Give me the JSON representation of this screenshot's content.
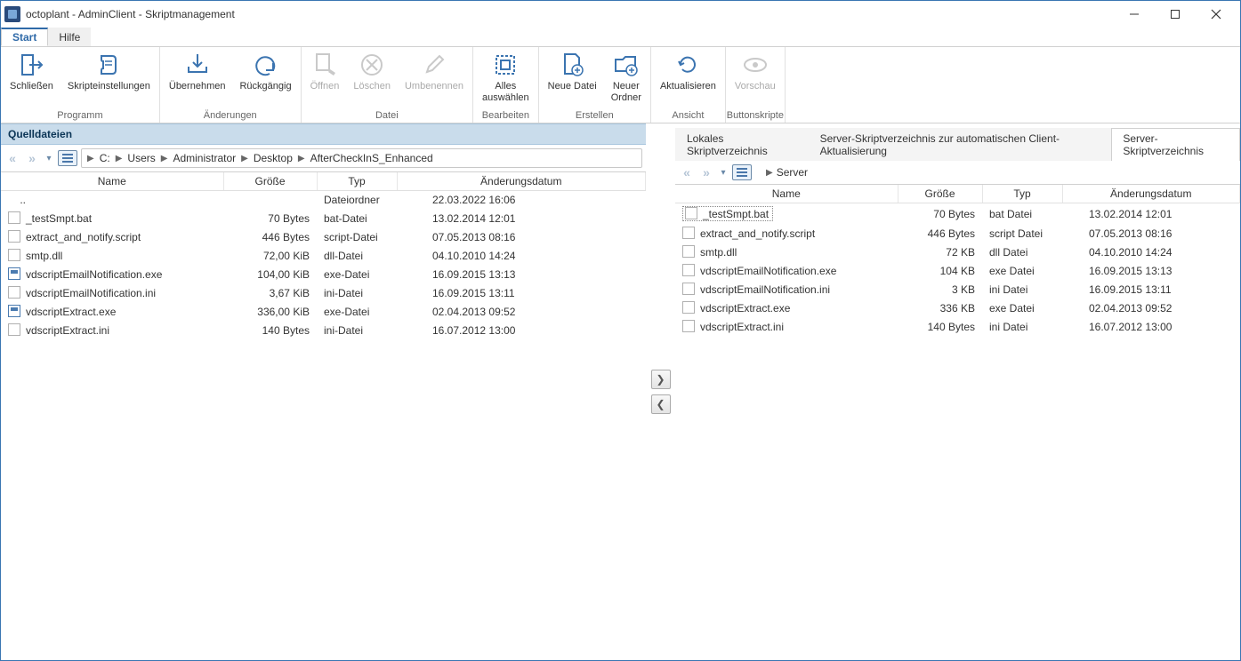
{
  "window": {
    "title": "octoplant - AdminClient - Skriptmanagement"
  },
  "menu": {
    "start": "Start",
    "help": "Hilfe"
  },
  "ribbon": {
    "close": "Schließen",
    "settings": "Skripteinstellungen",
    "group_program": "Programm",
    "apply": "Übernehmen",
    "undo": "Rückgängig",
    "group_changes": "Änderungen",
    "open": "Öffnen",
    "delete": "Löschen",
    "rename": "Umbenennen",
    "group_file": "Datei",
    "select_all1": "Alles",
    "select_all2": "auswählen",
    "group_edit": "Bearbeiten",
    "new_file": "Neue Datei",
    "new_folder1": "Neuer",
    "new_folder2": "Ordner",
    "group_create": "Erstellen",
    "refresh": "Aktualisieren",
    "group_view": "Ansicht",
    "preview": "Vorschau",
    "group_button": "Buttonskripte"
  },
  "left": {
    "header": "Quelldateien",
    "breadcrumb": [
      "C:",
      "Users",
      "Administrator",
      "Desktop",
      "AfterCheckInS_Enhanced"
    ],
    "columns": {
      "name": "Name",
      "size": "Größe",
      "type": "Typ",
      "date": "Änderungsdatum"
    },
    "parent_type": "Dateiordner",
    "parent_date": "22.03.2022 16:06",
    "rows": [
      {
        "name": "_testSmpt.bat",
        "size": "70 Bytes",
        "type": "bat-Datei",
        "date": "13.02.2014 12:01",
        "icon": "bat"
      },
      {
        "name": "extract_and_notify.script",
        "size": "446 Bytes",
        "type": "script-Datei",
        "date": "07.05.2013 08:16",
        "icon": "txt"
      },
      {
        "name": "smtp.dll",
        "size": "72,00 KiB",
        "type": "dll-Datei",
        "date": "04.10.2010 14:24",
        "icon": "dll"
      },
      {
        "name": "vdscriptEmailNotification.exe",
        "size": "104,00 KiB",
        "type": "exe-Datei",
        "date": "16.09.2015 13:13",
        "icon": "exe"
      },
      {
        "name": "vdscriptEmailNotification.ini",
        "size": "3,67 KiB",
        "type": "ini-Datei",
        "date": "16.09.2015 13:11",
        "icon": "ini"
      },
      {
        "name": "vdscriptExtract.exe",
        "size": "336,00 KiB",
        "type": "exe-Datei",
        "date": "02.04.2013 09:52",
        "icon": "exe"
      },
      {
        "name": "vdscriptExtract.ini",
        "size": "140 Bytes",
        "type": "ini-Datei",
        "date": "16.07.2012 13:00",
        "icon": "ini"
      }
    ]
  },
  "right": {
    "tabs": [
      "Lokales Skriptverzeichnis",
      "Server-Skriptverzeichnis zur automatischen Client-Aktualisierung",
      "Server-Skriptverzeichnis"
    ],
    "active_tab": 2,
    "breadcrumb": [
      "Server"
    ],
    "columns": {
      "name": "Name",
      "size": "Größe",
      "type": "Typ",
      "date": "Änderungsdatum"
    },
    "rows": [
      {
        "name": "_testSmpt.bat",
        "size": "70 Bytes",
        "type": "bat Datei",
        "date": "13.02.2014 12:01",
        "selected": true
      },
      {
        "name": "extract_and_notify.script",
        "size": "446 Bytes",
        "type": "script Datei",
        "date": "07.05.2013 08:16"
      },
      {
        "name": "smtp.dll",
        "size": "72 KB",
        "type": "dll Datei",
        "date": "04.10.2010 14:24"
      },
      {
        "name": "vdscriptEmailNotification.exe",
        "size": "104 KB",
        "type": "exe Datei",
        "date": "16.09.2015 13:13"
      },
      {
        "name": "vdscriptEmailNotification.ini",
        "size": "3 KB",
        "type": "ini Datei",
        "date": "16.09.2015 13:11"
      },
      {
        "name": "vdscriptExtract.exe",
        "size": "336 KB",
        "type": "exe Datei",
        "date": "02.04.2013 09:52"
      },
      {
        "name": "vdscriptExtract.ini",
        "size": "140 Bytes",
        "type": "ini Datei",
        "date": "16.07.2012 13:00"
      }
    ]
  }
}
